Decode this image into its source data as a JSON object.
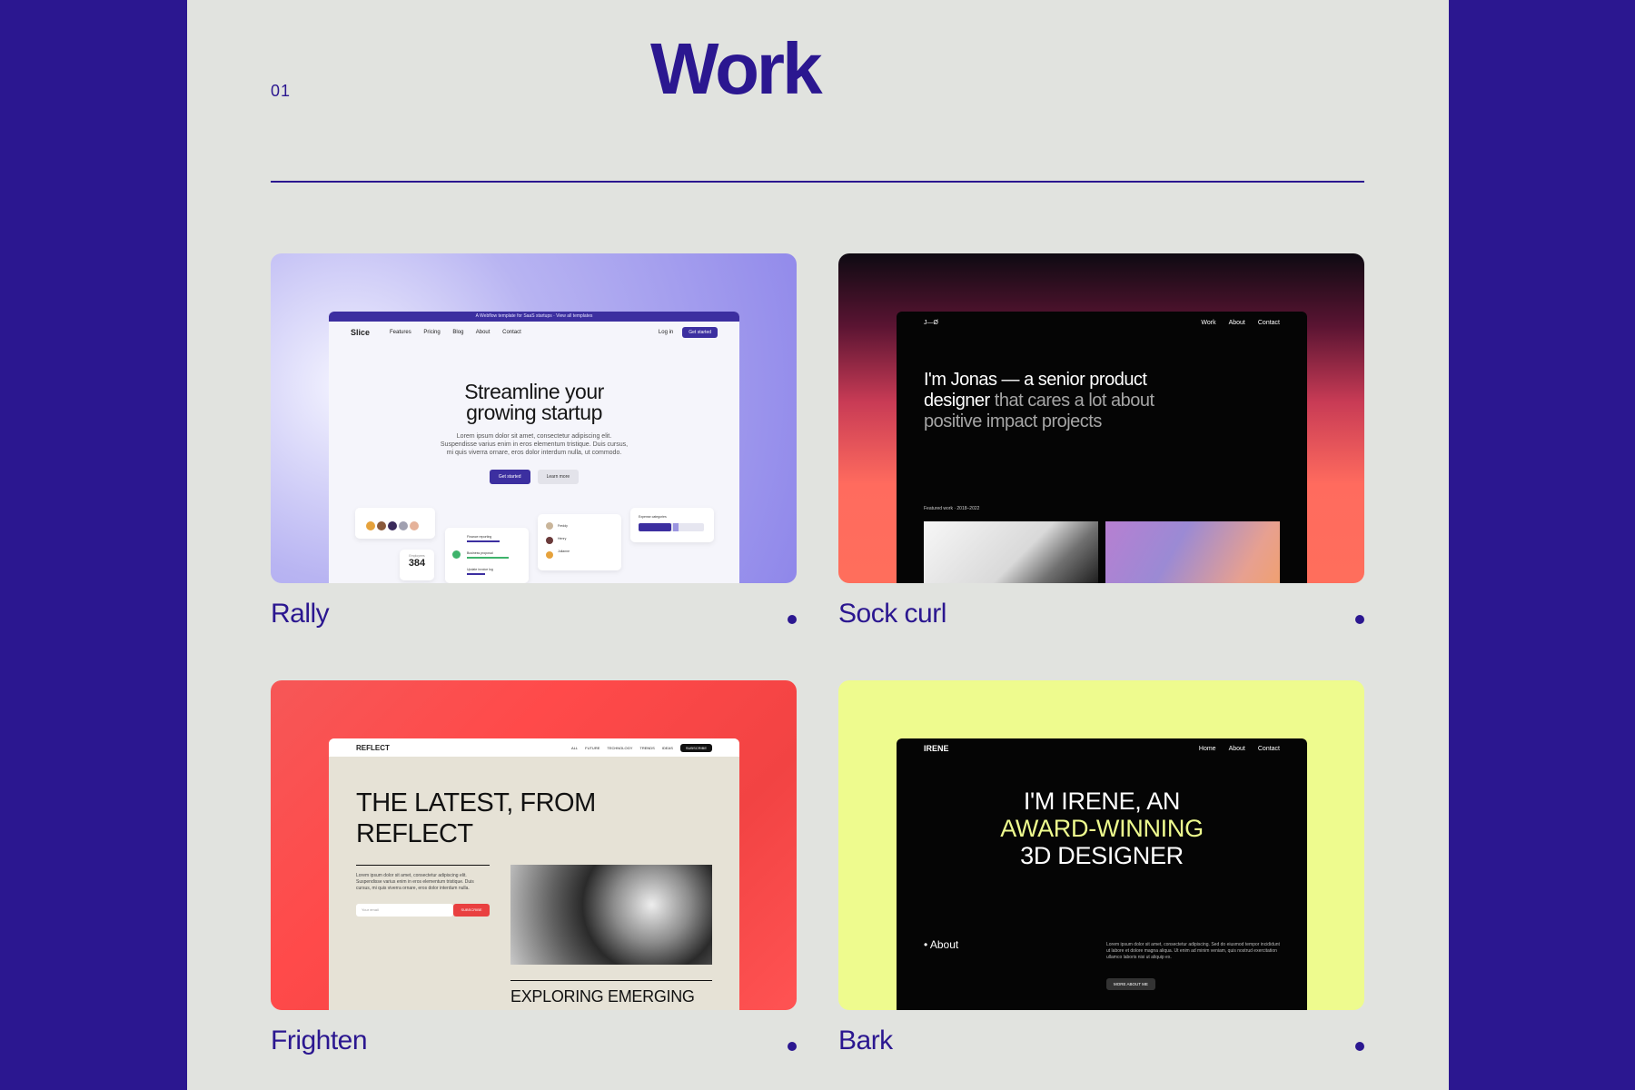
{
  "section": {
    "number": "01",
    "title": "Work"
  },
  "colors": {
    "frame": "#2b1790",
    "page": "#e1e3df",
    "accent": "#2b1790"
  },
  "projects": [
    {
      "title": "Rally",
      "preview": {
        "banner": "A Webflow template for SaaS startups · View all templates",
        "logo": "Slice",
        "nav": [
          "Features",
          "Pricing",
          "Blog",
          "About",
          "Contact"
        ],
        "login": "Log in",
        "get_started": "Get started",
        "headline_1": "Streamline your",
        "headline_2": "growing startup",
        "body": "Lorem ipsum dolor sit amet, consectetur adipiscing elit. Suspendisse varius enim in eros elementum tristique. Duis cursus, mi quis viverra ornare, eros dolor interdum nulla, ut commodo.",
        "cta_primary": "Get started",
        "cta_secondary": "Learn more",
        "stat_label": "Employees",
        "stat_value": "384",
        "tasks": [
          "Finance reporting",
          "Business proposal",
          "Update invoice log"
        ],
        "people": [
          "Freddy",
          "Henry",
          "Julianne"
        ],
        "expense_label": "Expense categories"
      }
    },
    {
      "title": "Sock curl",
      "preview": {
        "logo": "J—Ø",
        "nav": [
          "Work",
          "About",
          "Contact"
        ],
        "headline_bright": "I'm Jonas — a senior product designer",
        "headline_dim": " that cares a lot about positive impact projects",
        "featured": "Featured work · 2018–2022"
      }
    },
    {
      "title": "Frighten",
      "preview": {
        "logo": "REFLECT",
        "nav": [
          "ALL",
          "FUTURE",
          "TECHNOLOGY",
          "TRENDS",
          "IDEAS"
        ],
        "subscribe": "SUBSCRIBE",
        "headline_1": "THE LATEST, FROM",
        "headline_2": "REFLECT",
        "body": "Lorem ipsum dolor sit amet, consectetur adipiscing elit. Suspendisse varius enim in eros elementum tristique. Duis cursus, mi quis viverra ornare, eros dolor interdum nulla.",
        "email_placeholder": "Your email",
        "subscribe_btn": "SUBSCRIBE",
        "article": "EXPLORING EMERGING"
      }
    },
    {
      "title": "Bark",
      "preview": {
        "logo": "IRENE",
        "nav": [
          "Home",
          "About",
          "Contact"
        ],
        "headline_1": "I'M IRENE, AN",
        "headline_2": "AWARD-WINNING",
        "headline_3": "3D DESIGNER",
        "about": "• About",
        "body": "Lorem ipsum dolor sit amet, consectetur adipiscing. Sed do eiusmod tempor incididunt ut labore et dolore magna aliqua. Ut enim ad minim veniam, quis nostrud exercitation ullamco laboris nisi ut aliquip ex.",
        "more": "MORE ABOUT ME"
      }
    }
  ]
}
